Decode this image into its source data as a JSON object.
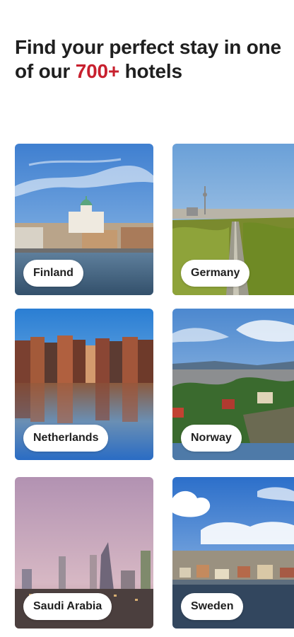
{
  "headline": {
    "prefix": "Find your perfect stay in one of our ",
    "accent": "700+",
    "suffix": " hotels"
  },
  "destinations": [
    {
      "label": "Finland"
    },
    {
      "label": "Germany"
    },
    {
      "label": "Netherlands"
    },
    {
      "label": "Norway"
    },
    {
      "label": "Saudi Arabia"
    },
    {
      "label": "Sweden"
    }
  ],
  "colors": {
    "accent": "#c8202e",
    "text": "#1f1f1f"
  }
}
